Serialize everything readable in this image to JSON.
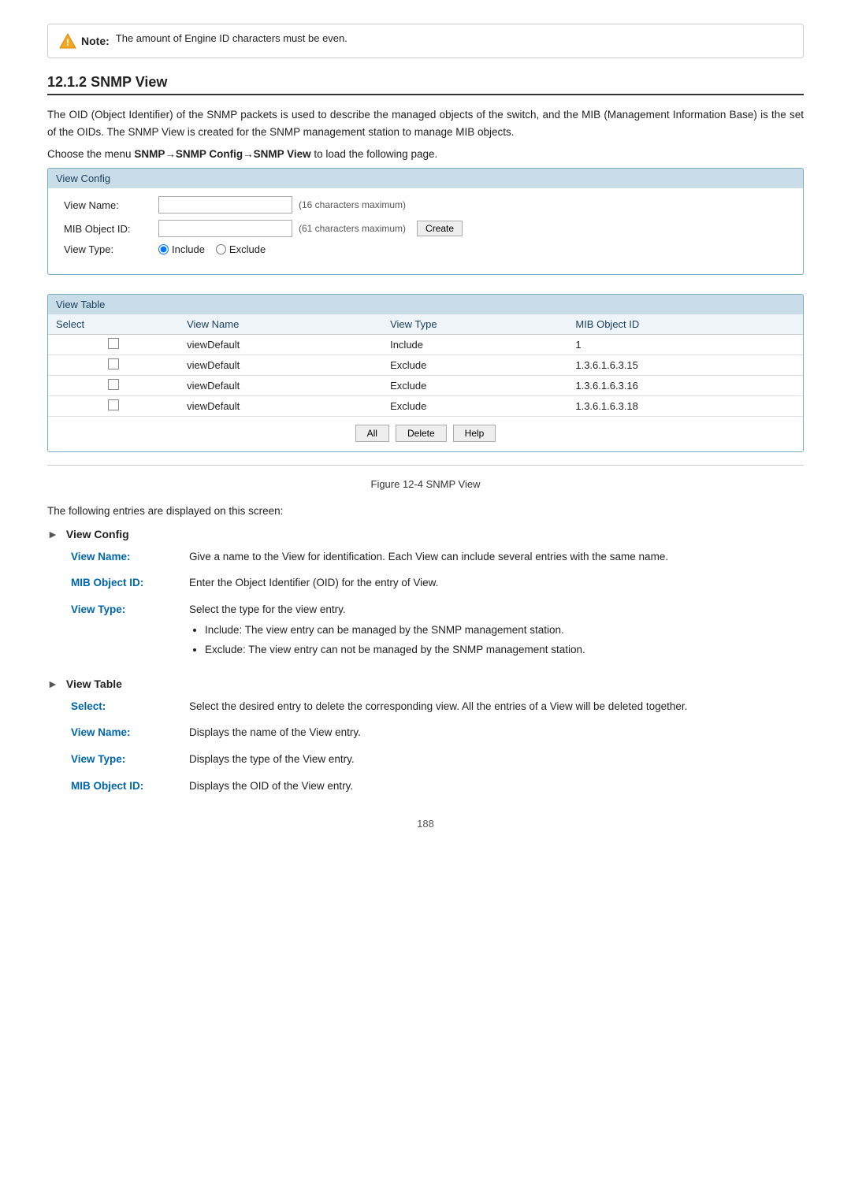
{
  "note": {
    "title": "Note:",
    "text": "The amount of Engine ID characters must be even."
  },
  "section": {
    "number": "12.1.2",
    "title": "SNMP View"
  },
  "description": {
    "para1": "The OID (Object Identifier) of the SNMP packets is used to describe the managed objects of the switch, and the MIB (Management Information Base) is the set of the OIDs. The SNMP View is created for the SNMP management station to manage MIB objects.",
    "menu_instruction": "Choose the menu SNMP→SNMP Config→SNMP View to load the following page."
  },
  "view_config": {
    "header": "View Config",
    "view_name_label": "View Name:",
    "view_name_hint": "(16 characters maximum)",
    "mib_object_id_label": "MIB Object ID:",
    "mib_object_id_hint": "(61 characters maximum)",
    "create_button": "Create",
    "view_type_label": "View Type:",
    "include_label": "Include",
    "exclude_label": "Exclude"
  },
  "view_table": {
    "header": "View Table",
    "columns": [
      "Select",
      "View Name",
      "View Type",
      "MIB Object ID"
    ],
    "rows": [
      {
        "view_name": "viewDefault",
        "view_type": "Include",
        "mib_object_id": "1"
      },
      {
        "view_name": "viewDefault",
        "view_type": "Exclude",
        "mib_object_id": "1.3.6.1.6.3.15"
      },
      {
        "view_name": "viewDefault",
        "view_type": "Exclude",
        "mib_object_id": "1.3.6.1.6.3.16"
      },
      {
        "view_name": "viewDefault",
        "view_type": "Exclude",
        "mib_object_id": "1.3.6.1.6.3.18"
      }
    ],
    "buttons": [
      "All",
      "Delete",
      "Help"
    ]
  },
  "figure_caption": "Figure 12-4 SNMP View",
  "screen_entries": "The following entries are displayed on this screen:",
  "view_config_section": {
    "heading": "View Config",
    "fields": [
      {
        "term": "View Name:",
        "def": "Give a name to the View for identification. Each View can include several entries with the same name."
      },
      {
        "term": "MIB Object ID:",
        "def": "Enter the Object Identifier (OID) for the entry of View."
      },
      {
        "term": "View Type:",
        "def": "Select the type for the view entry.",
        "bullets": [
          "Include: The view entry can be managed by the SNMP management station.",
          "Exclude: The view entry can not be managed by the SNMP management station."
        ]
      }
    ]
  },
  "view_table_section": {
    "heading": "View Table",
    "fields": [
      {
        "term": "Select:",
        "def": "Select the desired entry to delete the corresponding view. All the entries of a View will be deleted together."
      },
      {
        "term": "View Name:",
        "def": "Displays the name of the View entry."
      },
      {
        "term": "View Type:",
        "def": "Displays the type of the View entry."
      },
      {
        "term": "MIB Object ID:",
        "def": "Displays the OID of the View entry."
      }
    ]
  },
  "page_number": "188"
}
